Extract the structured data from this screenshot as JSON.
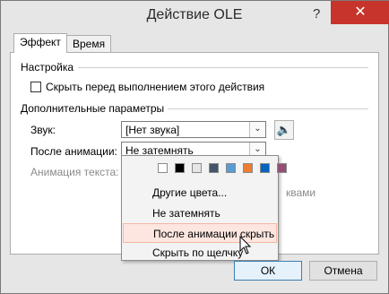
{
  "window": {
    "title": "Действие OLE",
    "help_label": "?",
    "close_label": "✕"
  },
  "tabs": [
    {
      "label": "Эффект",
      "active": true
    },
    {
      "label": "Время",
      "active": false
    }
  ],
  "settings": {
    "group_label": "Настройка",
    "hide_checkbox": {
      "label": "Скрыть перед выполнением этого действия",
      "checked": false
    }
  },
  "extra": {
    "group_label": "Дополнительные параметры",
    "sound": {
      "label": "Звук:",
      "value": "[Нет звука]"
    },
    "after_animation": {
      "label": "После анимации:",
      "value": "Не затемнять"
    },
    "text_animation": {
      "label": "Анимация текста:",
      "suffix": "квами"
    }
  },
  "dropdown": {
    "swatches": [
      "#ffffff",
      "#000000",
      "#e7e6e6",
      "#44546a",
      "#5b9bd5",
      "#ed7d31",
      "#0563c1",
      "#954f72"
    ],
    "items": [
      {
        "label": "Другие цвета..."
      },
      {
        "label": "Не затемнять"
      },
      {
        "label": "После анимации скрыть",
        "highlighted": true
      },
      {
        "label": "Скрыть по щелчку"
      }
    ]
  },
  "buttons": {
    "ok": "ОК",
    "cancel": "Отмена"
  }
}
